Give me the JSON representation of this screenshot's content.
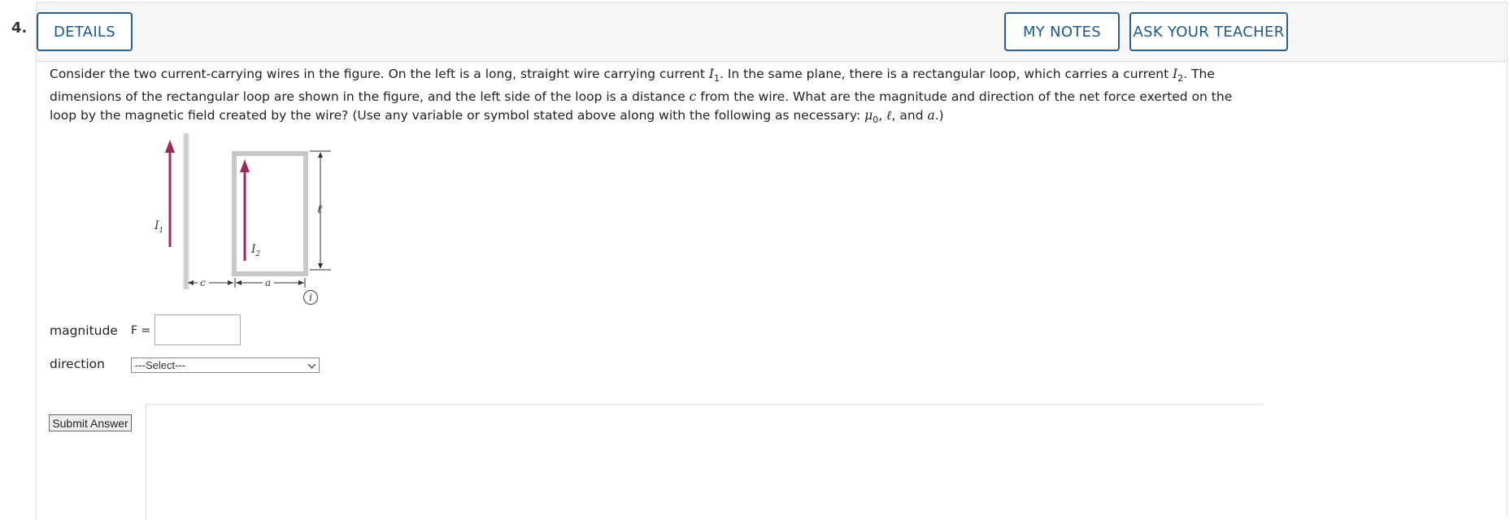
{
  "question": {
    "number": "4.",
    "details_label": "DETAILS",
    "my_notes_label": "MY NOTES",
    "ask_teacher_label": "ASK YOUR TEACHER",
    "text_parts": {
      "p1": "Consider the two current-carrying wires in the figure. On the left is a long, straight wire carrying current ",
      "v1": "I",
      "s1": "1",
      "p2": ". In the same plane, there is a rectangular loop, which carries a current ",
      "v2": "I",
      "s2": "2",
      "p3": ". The dimensions of the rectangular loop are shown in the figure, and the left side of the loop is a distance ",
      "v3": "c",
      "p4": " from the wire. What are the magnitude and direction of the net force exerted on the loop by the magnetic field created by the wire? (Use any variable or symbol stated above along with the following as necessary: ",
      "v4": "μ",
      "s4": "0",
      "p5": ", ",
      "v5": "ℓ",
      "p6": ", and ",
      "v6": "a",
      "p7": ".)"
    }
  },
  "figure": {
    "label_I1": "I",
    "label_I1_sub": "1",
    "label_I2": "I",
    "label_I2_sub": "2",
    "label_l": "ℓ",
    "label_c": "c",
    "label_a": "a",
    "colors": {
      "arrow": "#9b2c5e",
      "wire": "#d0d0d0",
      "loop": "#c8c8c8"
    }
  },
  "info_icon": "i",
  "answer": {
    "magnitude_label": "magnitude",
    "f_label": "F =",
    "magnitude_value": "",
    "direction_label": "direction",
    "direction_selected": "---Select---",
    "submit_label": "Submit Answer"
  }
}
